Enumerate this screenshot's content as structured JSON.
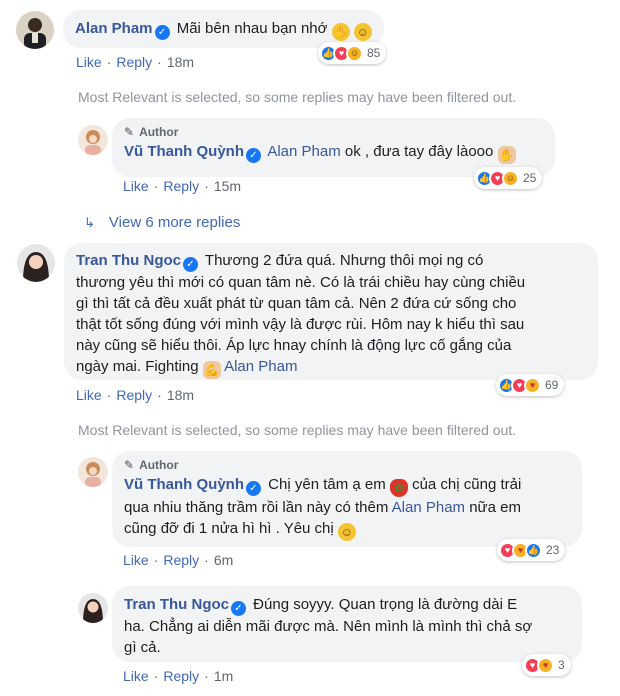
{
  "c1": {
    "name": "Alan Pham",
    "text": "Mãi bên nhau bạn nhớ",
    "reaction_count": "85",
    "like": "Like",
    "reply": "Reply",
    "time": "18m"
  },
  "notice1": "Most Relevant is selected, so some replies may have been filtered out.",
  "r1": {
    "author_label": "Author",
    "name": "Vũ Thanh Quỳnh",
    "mention": "Alan Pham",
    "text": "ok , đưa tay đây làooo",
    "reaction_count": "25",
    "like": "Like",
    "reply": "Reply",
    "time": "15m"
  },
  "view_more": "View 6 more replies",
  "c2": {
    "name": "Tran Thu Ngoc",
    "text_l1": "Thương 2 đứa quá. Nhưng thôi mọi ng có",
    "text_l2": "thương yêu thì mới có quan tâm nè. Có là trái chiều hay cùng chiều",
    "text_l3": "gì thì tất cả đều xuất phát từ quan tâm cả. Nên 2 đứa cứ sống cho",
    "text_l4": "thật tốt sống đúng với mình vậy là được rùi. Hôm nay k hiểu thì sau",
    "text_l5": "này cũng sẽ hiểu thôi. Áp lực hnay chính là động lực cố gắng của",
    "text_l6": "ngày mai. Fighting",
    "mention": "Alan Pham",
    "reaction_count": "69",
    "like": "Like",
    "reply": "Reply",
    "time": "18m"
  },
  "notice2": "Most Relevant is selected, so some replies may have been filtered out.",
  "r2": {
    "author_label": "Author",
    "name": "Vũ Thanh Quỳnh",
    "text_a": "Chị yên tâm ạ em",
    "text_b": "của chị cũng trải",
    "text_l2": "qua nhiu thăng trầm rồi lần này có thêm",
    "mention": "Alan Pham",
    "text_l2b": "nữa em",
    "text_l3": "cũng đỡ đi 1 nửa hì hì . Yêu chị",
    "reaction_count": "23",
    "like": "Like",
    "reply": "Reply",
    "time": "6m"
  },
  "r3": {
    "name": "Tran Thu Ngoc",
    "text_l1": "Đúng soyyy. Quan trọng là đường dài E",
    "text_l2": "ha. Chẳng ai diễn mãi được mà. Nên mình là mình thì chả sợ",
    "text_l3": "gì cả.",
    "reaction_count": "3",
    "like": "Like",
    "reply": "Reply",
    "time": "1m"
  },
  "icons": {
    "verified": "verified-check-icon",
    "like": "like-reaction-icon",
    "love": "love-reaction-icon",
    "haha": "haha-reaction-icon",
    "care": "care-reaction-icon",
    "author": "pencil-icon",
    "reply_arrow": "reply-arrow-icon"
  },
  "colors": {
    "name": "#385898",
    "link": "#4267b2",
    "bubble": "#f2f3f5",
    "notice": "#90949c"
  }
}
